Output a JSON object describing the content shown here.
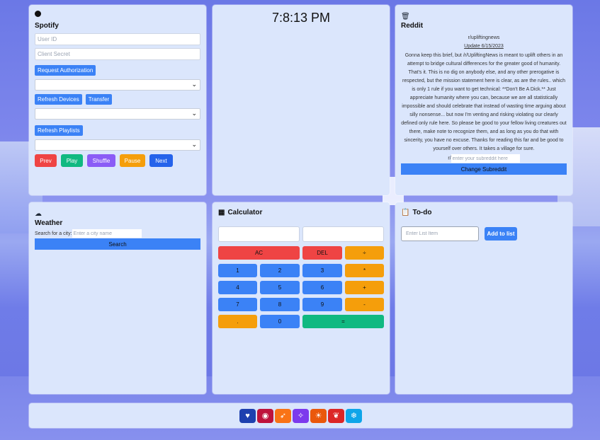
{
  "spotify": {
    "title": "Spotify",
    "user_id_placeholder": "User ID",
    "client_secret_placeholder": "Client Secret",
    "request_auth_label": "Request Authorization",
    "refresh_devices_label": "Refresh Devices",
    "transfer_label": "Transfer",
    "refresh_playlists_label": "Refresh Playlists",
    "controls": [
      {
        "label": "Prev",
        "color": "#ef4444"
      },
      {
        "label": "Play",
        "color": "#10b981"
      },
      {
        "label": "Shuffle",
        "color": "#8b5cf6"
      },
      {
        "label": "Pause",
        "color": "#f59e0b"
      },
      {
        "label": "Next",
        "color": "#2563eb"
      }
    ]
  },
  "clock": {
    "time": "7:8:13 PM"
  },
  "reddit": {
    "title": "Reddit",
    "subreddit": "r/upliftingnews",
    "post_title": "Update 6/15/2023",
    "post_body": "Gonna keep this brief, but /r/UpliftingNews is meant to uplift others in an attempt to bridge cultural differences for the greater good of humanity. That's it. This is no dig on anybody else, and any other prerogative is respected, but the mission statement here is clear, as are the rules.. which is only 1 rule if you want to get technical: **Don't Be A Dick.** Just appreciate humanity where you can, because we are all statistically impossible and should celebrate that instead of wasting time arguing about silly nonsense... but now I'm venting and risking violating our clearly defined only rule here. So please be good to your fellow living creatures out there, make note to recognize them, and as long as you do that with sincerity, you have no excuse. Thanks for reading this far and be good to yourself over others. It takes a village for sure.",
    "input_prefix": "r/",
    "input_placeholder": "enter your subreddit here",
    "change_button_label": "Change Subreddit"
  },
  "weather": {
    "title": "Weather",
    "city_label": "Search for a city:",
    "city_placeholder": "Enter a city name",
    "search_label": "Search"
  },
  "calculator": {
    "title": "Calculator",
    "keys": {
      "ac": "AC",
      "del": "DEL",
      "divide": "÷",
      "multiply": "*",
      "plus": "+",
      "minus": "-",
      "k1": "1",
      "k2": "2",
      "k3": "3",
      "k4": "4",
      "k5": "5",
      "k6": "6",
      "k7": "7",
      "k8": "8",
      "k9": "9",
      "dot": ".",
      "k0": "0",
      "equals": "="
    }
  },
  "todo": {
    "title": "To-do",
    "input_placeholder": "Enter List Item",
    "add_label": "Add to list"
  },
  "dock": {
    "icons": [
      {
        "name": "heart-icon",
        "glyph": "♥",
        "color": "#1e40af"
      },
      {
        "name": "gamepad-icon",
        "glyph": "◉",
        "color": "#be123c"
      },
      {
        "name": "rocket-icon",
        "glyph": "➶",
        "color": "#f97316"
      },
      {
        "name": "wand-icon",
        "glyph": "✧",
        "color": "#7c3aed"
      },
      {
        "name": "sunset-icon",
        "glyph": "☀",
        "color": "#ea580c"
      },
      {
        "name": "leaf-icon",
        "glyph": "❦",
        "color": "#dc2626"
      },
      {
        "name": "snowflake-icon",
        "glyph": "❄",
        "color": "#0ea5e9"
      }
    ]
  }
}
